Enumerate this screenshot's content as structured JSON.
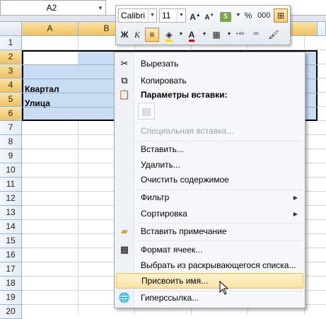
{
  "name_box": {
    "value": "A2"
  },
  "columns": [
    "A",
    "B"
  ],
  "rows": [
    "1",
    "2",
    "3",
    "4",
    "5",
    "6",
    "7",
    "8",
    "9",
    "10",
    "11",
    "12",
    "13",
    "14",
    "15",
    "16",
    "17",
    "18",
    "19",
    "20"
  ],
  "cells": {
    "A4": "Квартал",
    "A5": "Улица"
  },
  "mini_toolbar": {
    "font_name": "Calibri",
    "font_size": "11",
    "percent": "%",
    "thousands": "000",
    "bold": "Ж",
    "italic": "К",
    "increase_font": "A",
    "decrease_font": "A",
    "font_color_letter": "A",
    "decimal_inc": "⁺⁰⁰",
    "decimal_dec": "⁰⁰",
    "currency": "$"
  },
  "context_menu": {
    "cut": "Вырезать",
    "copy": "Копировать",
    "paste_options": "Параметры вставки:",
    "paste_special": "Специальная вставка...",
    "insert": "Вставить...",
    "delete": "Удалить...",
    "clear": "Очистить содержимое",
    "filter": "Фильтр",
    "sort": "Сортировка",
    "insert_comment": "Вставить примечание",
    "format_cells": "Формат ячеек...",
    "pick_from_list": "Выбрать из раскрывающегося списка...",
    "define_name": "Присвоить имя...",
    "hyperlink": "Гиперссылка..."
  },
  "colors": {
    "selection_fill": "#c8ddf3",
    "header_highlight": "#f1c15f",
    "menu_hover": "#fbe2a0"
  }
}
